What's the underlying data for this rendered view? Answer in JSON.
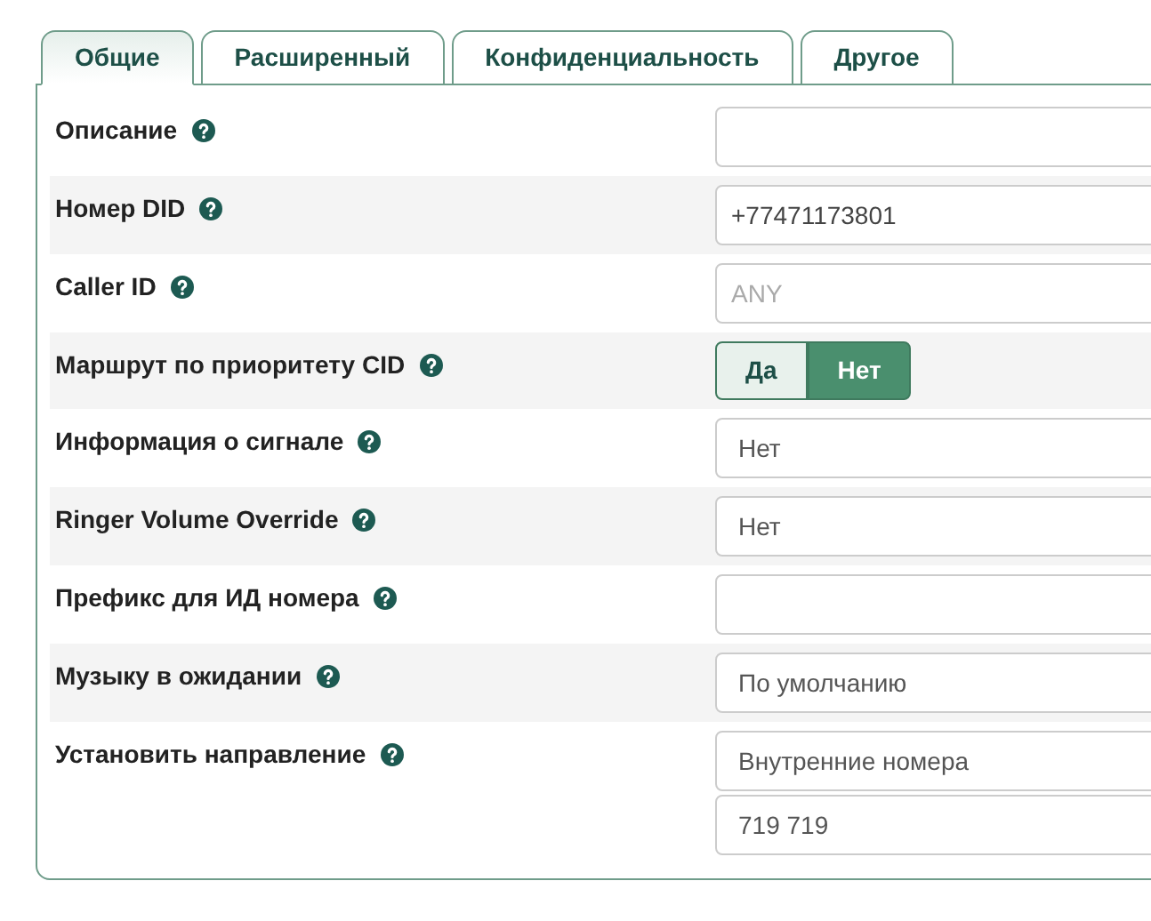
{
  "tabs": [
    {
      "label": "Общие",
      "selected": true
    },
    {
      "label": "Расширенный",
      "selected": false
    },
    {
      "label": "Конфиденциальность",
      "selected": false
    },
    {
      "label": "Другое",
      "selected": false
    }
  ],
  "rows": [
    {
      "label": "Описание",
      "fields": [
        {
          "kind": "input"
        }
      ]
    },
    {
      "label": "Номер DID",
      "fields": [
        {
          "kind": "input",
          "value": "+77471173801"
        }
      ]
    },
    {
      "label": "Caller ID",
      "fields": [
        {
          "kind": "input",
          "placeholder": "ANY"
        }
      ]
    },
    {
      "label": "Маршрут по приоритету CID",
      "fields": [
        {
          "kind": "toggle",
          "options": [
            {
              "label": "Да",
              "selected": false
            },
            {
              "label": "Нет",
              "selected": true
            }
          ]
        }
      ]
    },
    {
      "label": "Информация о сигнале",
      "fields": [
        {
          "kind": "select",
          "value": "Нет"
        }
      ]
    },
    {
      "label": "Ringer Volume Override",
      "fields": [
        {
          "kind": "select",
          "value": "Нет"
        }
      ]
    },
    {
      "label": "Префикс для ИД номера",
      "fields": [
        {
          "kind": "input"
        }
      ]
    },
    {
      "label": "Музыку в ожидании",
      "fields": [
        {
          "kind": "select",
          "value": "По умолчанию"
        }
      ]
    },
    {
      "label": "Установить направление",
      "fields": [
        {
          "kind": "select",
          "value": "Внутренние номера"
        },
        {
          "kind": "select",
          "value": "719 719"
        }
      ]
    }
  ]
}
